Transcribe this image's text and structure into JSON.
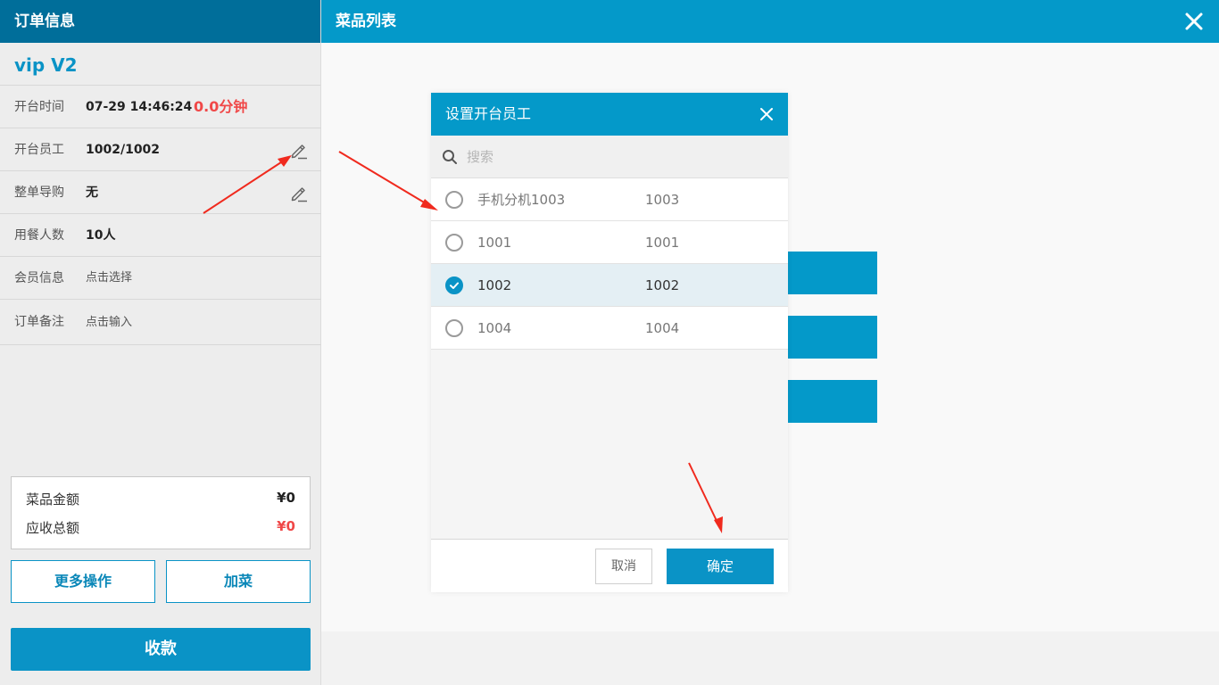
{
  "order_panel": {
    "title": "订单信息",
    "table_name": "vip V2",
    "rows": [
      {
        "label": "开台时间",
        "value": "07-29 14:46:24",
        "duration": "0.0分钟"
      },
      {
        "label": "开台员工",
        "value": "1002/1002"
      },
      {
        "label": "整单导购",
        "value": "无"
      },
      {
        "label": "用餐人数",
        "value": "10人"
      },
      {
        "label": "会员信息",
        "value": "点击选择"
      },
      {
        "label": "订单备注",
        "value": "点击输入"
      }
    ],
    "summary": {
      "dish_amount_label": "菜品金额",
      "dish_amount": "¥0",
      "receivable_label": "应收总额",
      "receivable": "¥0"
    },
    "more_actions": "更多操作",
    "add_dish": "加菜",
    "checkout": "收款"
  },
  "main": {
    "title": "菜品列表"
  },
  "dialog": {
    "title": "设置开台员工",
    "search_placeholder": "搜索",
    "employees": [
      {
        "name": "手机分机1003",
        "code": "1003",
        "selected": false
      },
      {
        "name": "1001",
        "code": "1001",
        "selected": false
      },
      {
        "name": "1002",
        "code": "1002",
        "selected": true
      },
      {
        "name": "1004",
        "code": "1004",
        "selected": false
      }
    ],
    "cancel": "取消",
    "confirm": "确定"
  },
  "colors": {
    "accent": "#0499c9",
    "dark_header": "#006e9a",
    "alert_red": "#f04848",
    "annotation_arrow": "#f02a1e"
  }
}
